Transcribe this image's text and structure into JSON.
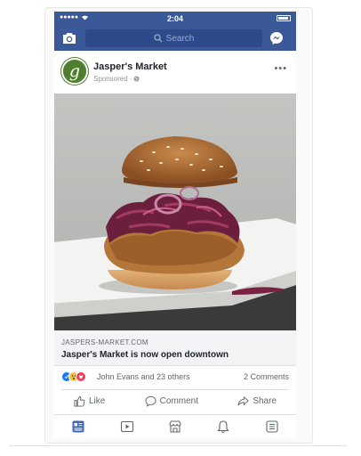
{
  "status_bar": {
    "signal": "●●●●●",
    "time": "2:04"
  },
  "nav": {
    "search_placeholder": "Search",
    "icons": [
      "camera-icon",
      "search-icon",
      "messenger-icon"
    ]
  },
  "post": {
    "page_name": "Jasper's Market",
    "avatar_letter": "g",
    "sponsored_label": "Sponsored",
    "more_label": "•••",
    "link_domain": "JASPERS-MARKET.COM",
    "link_title": "Jasper's Market is now open downtown",
    "reactions_text": "John Evans and 23 others",
    "comments_text": "2 Comments"
  },
  "actions": {
    "like": "Like",
    "comment": "Comment",
    "share": "Share"
  },
  "tabs": [
    "news-feed-icon",
    "video-icon",
    "marketplace-icon",
    "notifications-icon",
    "menu-icon"
  ],
  "colors": {
    "brand": "#3b5998",
    "active_tab": "#4267b2",
    "muted": "#606770"
  }
}
